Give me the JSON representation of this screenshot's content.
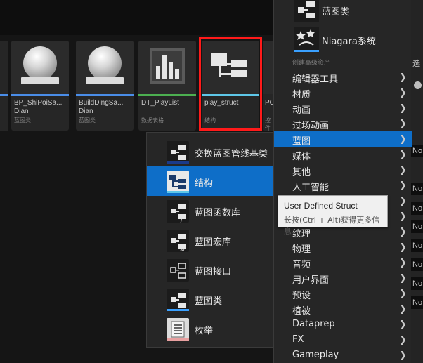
{
  "assets": [
    {
      "name": "BP_ShiPoiSa...",
      "name2": "Dian",
      "type": "蓝图类",
      "bar": "#4a8de8"
    },
    {
      "name": "BuildDingSa...",
      "name2": "Dian",
      "type": "蓝图类",
      "bar": "#4a8de8"
    },
    {
      "name": "DT_PlayList",
      "type": "数据表格",
      "bar": "#4caf50"
    },
    {
      "name": "play_struct",
      "type": "结构",
      "bar": "#5ec7e8"
    },
    {
      "name": "PC",
      "type": "控件"
    }
  ],
  "right_panel": {
    "label_top": "选",
    "fields": [
      "No",
      "No",
      "No",
      "No",
      "No",
      "No",
      "No",
      "No"
    ]
  },
  "menu": {
    "top_items": [
      "蓝图类",
      "Niagara系统"
    ],
    "section_title": "创建高级资产",
    "items": [
      "编辑器工具",
      "材质",
      "动画",
      "过场动画",
      "蓝图",
      "媒体",
      "其他",
      "人工智能",
      "",
      "",
      "纹理",
      "物理",
      "音频",
      "用户界面",
      "预设",
      "植被",
      "Dataprep",
      "FX",
      "Gameplay"
    ],
    "selected_index": 4
  },
  "submenu": {
    "items": [
      "交换蓝图管线基类",
      "结构",
      "蓝图函数库",
      "蓝图宏库",
      "蓝图接口",
      "蓝图类",
      "枚举"
    ],
    "selected_index": 1
  },
  "tooltip": {
    "title": "User Defined Struct",
    "hint": "长按(Ctrl + Alt)获得更多信息"
  },
  "colors": {
    "accent": "#0e6ec8",
    "selection_box": "#ff1a1a",
    "blueprint_bar": "#4a8de8",
    "struct_bar": "#5ec7e8",
    "datatable_bar": "#4caf50"
  }
}
